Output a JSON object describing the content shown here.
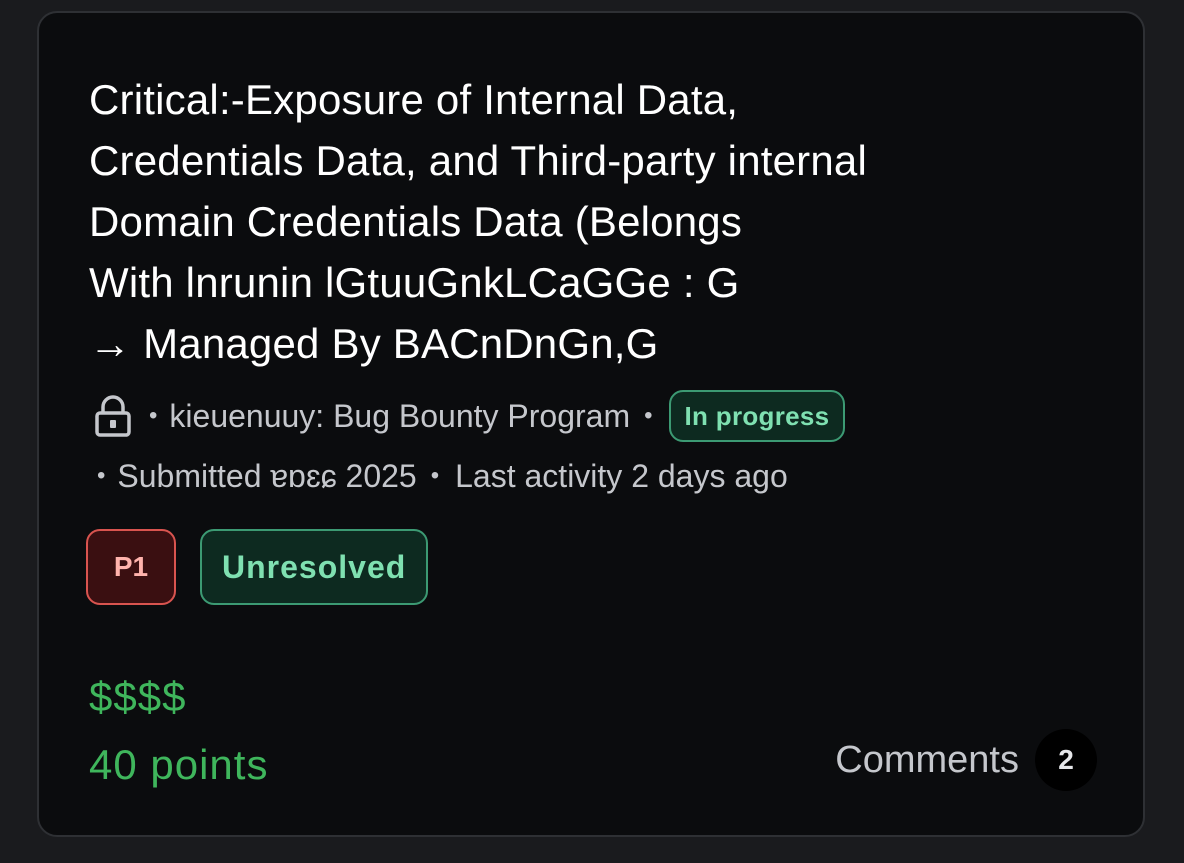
{
  "report": {
    "title_lines": [
      "Critical:-Exposure of Internal Data,",
      "Credentials Data, and Third-party internal",
      "Domain Credentials Data (Belongs",
      "With lnrunin lGtuuGnkLCaGGe : G",
      "→ Managed By BACnDnGn,G"
    ],
    "visibility_icon": "lock-icon",
    "separator": "•",
    "program": "kieuenuuy: Bug Bounty Program",
    "status": "In progress",
    "submitted": "Submitted ɐɒɛɕ 2025",
    "last_activity": "Last activity 2 days ago",
    "priority": "P1",
    "state": "Unresolved",
    "bounty": "$$$$",
    "points": "40 points",
    "comments_label": "Comments",
    "comments_count": "2"
  },
  "colors": {
    "background": "#1a1b1e",
    "card": "#0b0c0e",
    "text": "#ffffff",
    "muted": "#c5c7cc",
    "accent_green": "#3fb65c",
    "badge_green": "#7fe0b1",
    "badge_red": "#d9544f"
  }
}
